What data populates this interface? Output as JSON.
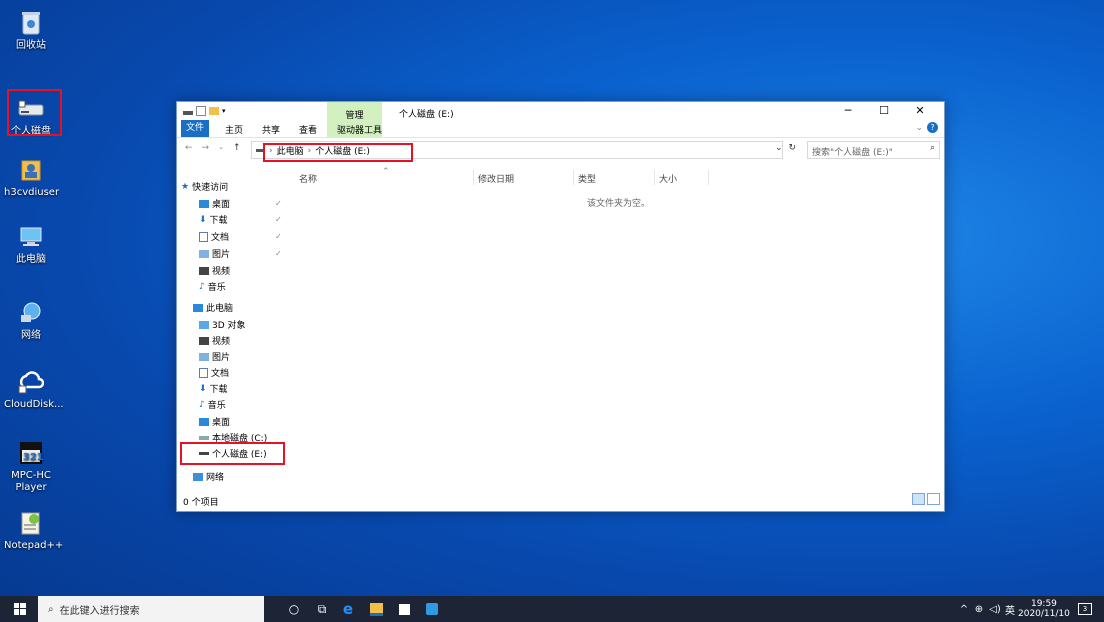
{
  "desktop": {
    "icons": [
      {
        "label": "回收站",
        "icon": "recycle-bin-icon"
      },
      {
        "label": "个人磁盘",
        "icon": "drive-icon"
      },
      {
        "label": "h3cvdiuser",
        "icon": "user-folder-icon"
      },
      {
        "label": "此电脑",
        "icon": "computer-icon"
      },
      {
        "label": "网络",
        "icon": "network-icon"
      },
      {
        "label": "CloudDisk...",
        "icon": "cloud-disk-icon"
      },
      {
        "label": "MPC-HC Player",
        "icon": "mpc-player-icon"
      },
      {
        "label": "Notepad++",
        "icon": "notepad-plus-icon"
      }
    ]
  },
  "explorer": {
    "title": "个人磁盘 (E:)",
    "context_tab": "管理",
    "ribbon_tabs": [
      "文件",
      "主页",
      "共享",
      "查看",
      "驱动器工具"
    ],
    "breadcrumb": [
      "此电脑",
      "个人磁盘 (E:)"
    ],
    "search_placeholder": "搜索\"个人磁盘 (E:)\"",
    "columns": [
      "名称",
      "修改日期",
      "类型",
      "大小"
    ],
    "empty_message": "该文件夹为空。",
    "status": "0 个项目",
    "nav": {
      "quick_access": "快速访问",
      "quick_items": [
        "桌面",
        "下载",
        "文档",
        "图片",
        "视频",
        "音乐"
      ],
      "this_pc": "此电脑",
      "pc_items": [
        "3D 对象",
        "视频",
        "图片",
        "文档",
        "下载",
        "音乐",
        "桌面",
        "本地磁盘 (C:)",
        "个人磁盘 (E:)"
      ],
      "network": "网络"
    }
  },
  "taskbar": {
    "search_placeholder": "在此键入进行搜索",
    "time": "19:59",
    "date": "2020/11/10",
    "ime": "英",
    "notifications": "3"
  },
  "colors": {
    "accent": "#1a6fc4",
    "highlight_box": "#e81123",
    "manage_tab": "#d3f0c1",
    "taskbar": "#1c2436"
  }
}
